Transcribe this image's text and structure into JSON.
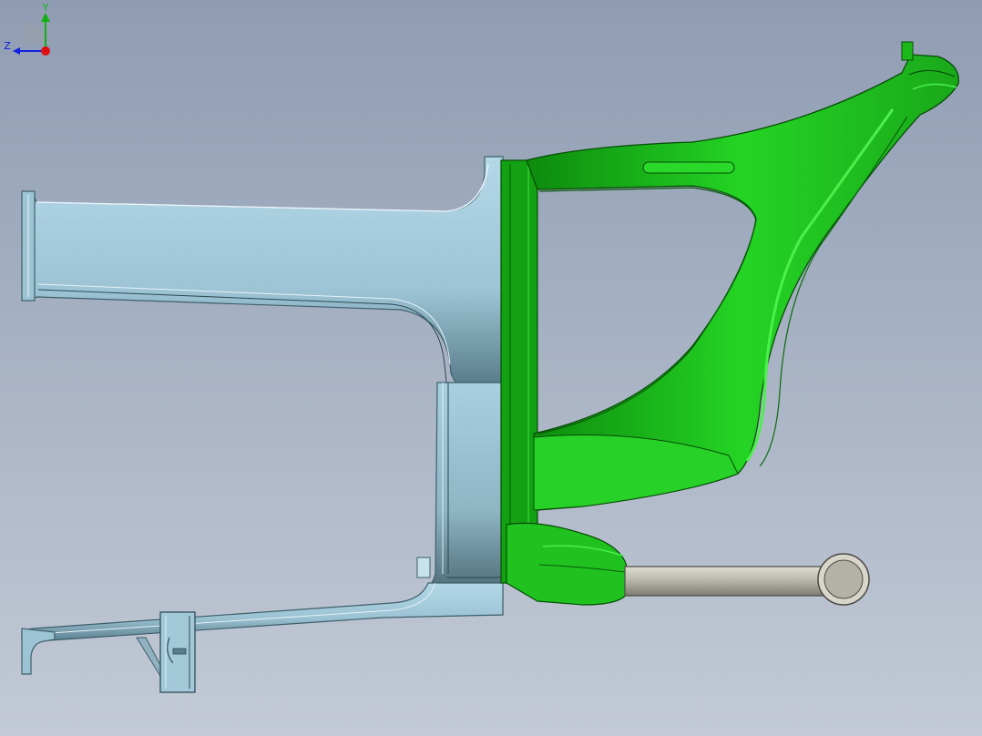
{
  "viewport": {
    "background_top": "#8f9cb2",
    "background_bottom": "#c3cad6"
  },
  "model": {
    "colors": {
      "frame_blue": "#a9cfe0",
      "frame_blue_dark": "#4d6f7c",
      "bracket_green": "#1fc21f",
      "bracket_green_dark": "#0a6f0a",
      "rod_gray": "#b9b7ad"
    },
    "parts": [
      {
        "name": "c-frame",
        "color_key": "frame_blue"
      },
      {
        "name": "green-bracket",
        "color_key": "bracket_green"
      },
      {
        "name": "rod",
        "color_key": "rod_gray"
      },
      {
        "name": "lower-clamp",
        "color_key": "frame_blue"
      }
    ]
  },
  "triad": {
    "x_label": "",
    "y_label": "Y",
    "z_label": "Z",
    "x_color": "#e01010",
    "y_color": "#12b012",
    "z_color": "#1020e0"
  }
}
